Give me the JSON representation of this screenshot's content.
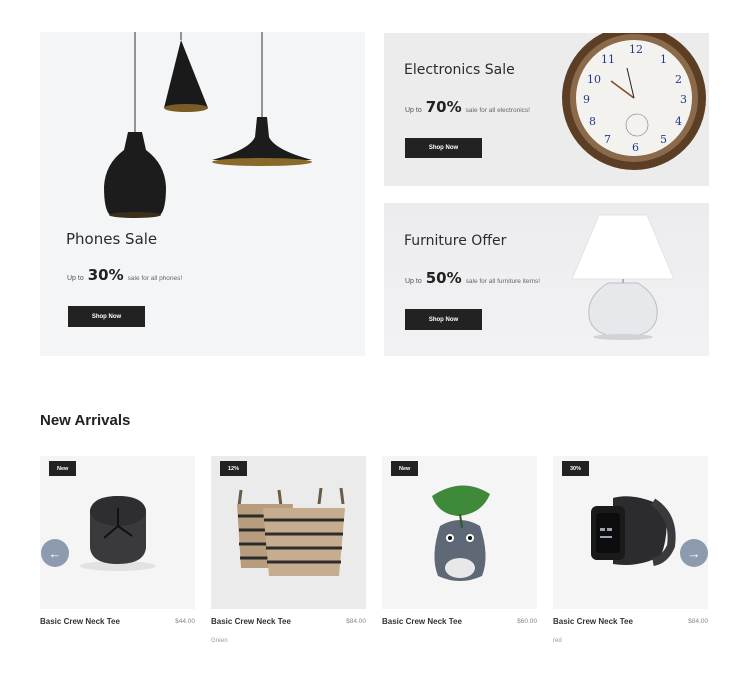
{
  "banners": {
    "phones": {
      "title": "Phones Sale",
      "up_to": "Up to",
      "percent": "30%",
      "desc": "sale for all phones!",
      "button": "Shop Now"
    },
    "electronics": {
      "title": "Electronics Sale",
      "up_to": "Up to",
      "percent": "70%",
      "desc": "sale for all electronics!",
      "button": "Shop Now"
    },
    "furniture": {
      "title": "Furniture Offer",
      "up_to": "Up to",
      "percent": "50%",
      "desc": "sale for all furniture items!",
      "button": "Shop Now"
    }
  },
  "new_arrivals": {
    "title": "New Arrivals",
    "products": [
      {
        "badge": "New",
        "name": "Basic Crew Neck Tee",
        "price": "$44.00",
        "variant": "",
        "icon": "clock-icon"
      },
      {
        "badge": "12%",
        "name": "Basic Crew Neck Tee",
        "price": "$84.00",
        "variant": "Green",
        "icon": "basket-icon"
      },
      {
        "badge": "New",
        "name": "Basic Crew Neck Tee",
        "price": "$60.00",
        "variant": "",
        "icon": "plush-toy-icon"
      },
      {
        "badge": "30%",
        "name": "Basic Crew Neck Tee",
        "price": "$84.00",
        "variant": "red",
        "icon": "smartwatch-icon"
      }
    ],
    "prev_icon": "arrow-left-icon",
    "next_icon": "arrow-right-icon"
  },
  "colors": {
    "button_bg": "#222222",
    "arrow_bg": "#8d9bb0",
    "banner_bg": "#f5f6f8"
  }
}
